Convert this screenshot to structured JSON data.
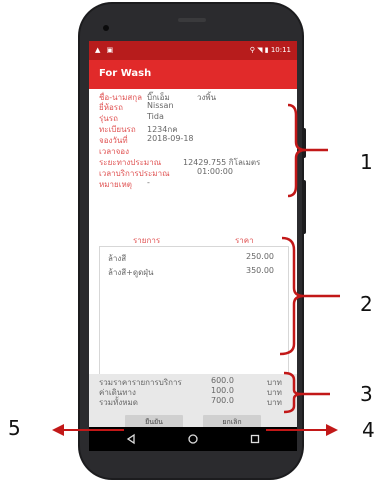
{
  "status_bar": {
    "left_icons": "▲ ▣",
    "right_text": "⚲ ◥ ▮ 10:11"
  },
  "app_bar": {
    "title": "For Wash"
  },
  "info": [
    {
      "label": "ชื่อ-นามสกุล",
      "value": "บิ๊กเอ็ม",
      "value2": "วงพิ้น"
    },
    {
      "label": "ยี่ห้อรถ",
      "value": "Nissan"
    },
    {
      "label": "รุ่นรถ",
      "value": "Tida"
    },
    {
      "label": "ทะเบียนรถ",
      "value": "1234กค"
    },
    {
      "label": "จองวันที่",
      "value": "2018-09-18"
    },
    {
      "label": "เวลาจอง",
      "value": ""
    },
    {
      "label": "ระยะทางประมาณ",
      "value": "12429.755 กิโลเมตร"
    },
    {
      "label": "เวลาบริการประมาณ",
      "value": "01:00:00"
    },
    {
      "label": "หมายเหตุ",
      "value": "-"
    }
  ],
  "columns": {
    "item": "รายการ",
    "price": "ราคา"
  },
  "items": [
    {
      "name": "ล้างสี",
      "price": "250.00"
    },
    {
      "name": "ล้างสี+ดูดฝุ่น",
      "price": "350.00"
    }
  ],
  "totals": [
    {
      "label": "รวมราคารายการบริการ",
      "value": "600.0",
      "unit": "บาท"
    },
    {
      "label": "ค่าเดินทาง",
      "value": "100.0",
      "unit": "บาท"
    },
    {
      "label": "รวมทั้งหมด",
      "value": "700.0",
      "unit": "บาท"
    }
  ],
  "buttons": {
    "confirm": "ยืนยัน",
    "cancel": "ยกเลิก"
  },
  "annotations": {
    "n1": "1",
    "n2": "2",
    "n3": "3",
    "n4": "4",
    "n5": "5"
  },
  "colors": {
    "status_bar": "#b71c1c",
    "app_bar": "#e12a2a",
    "label": "#e05353"
  },
  "nav_icons": [
    "back-icon",
    "home-icon",
    "recents-icon"
  ]
}
